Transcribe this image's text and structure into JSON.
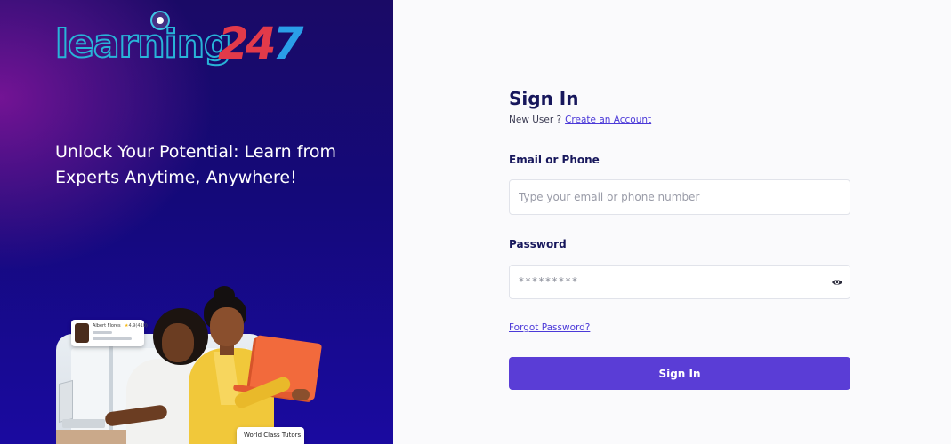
{
  "brand": {
    "logo_word": "learning",
    "logo_num_2": "2",
    "logo_num_4": "4",
    "logo_num_7": "7",
    "colors": {
      "cyan": "#3ec6e6",
      "red": "#e23a4a",
      "blue": "#2a9ee8"
    }
  },
  "hero": {
    "tagline": "Unlock Your Potential: Learn from Experts Anytime, Anywhere!",
    "tutor_card": {
      "name": "Albert Flores",
      "rating": "4.9(410)"
    },
    "badge": "World Class Tutors"
  },
  "form": {
    "title": "Sign In",
    "new_user_prefix": "New User ?",
    "create_account_link": "Create an Account",
    "email_label": "Email or Phone",
    "email_placeholder": "Type your email or phone number",
    "password_label": "Password",
    "password_mask": "*********",
    "forgot_link": "Forgot Password?",
    "submit_label": "Sign In",
    "accent_color": "#5a3dd6"
  }
}
